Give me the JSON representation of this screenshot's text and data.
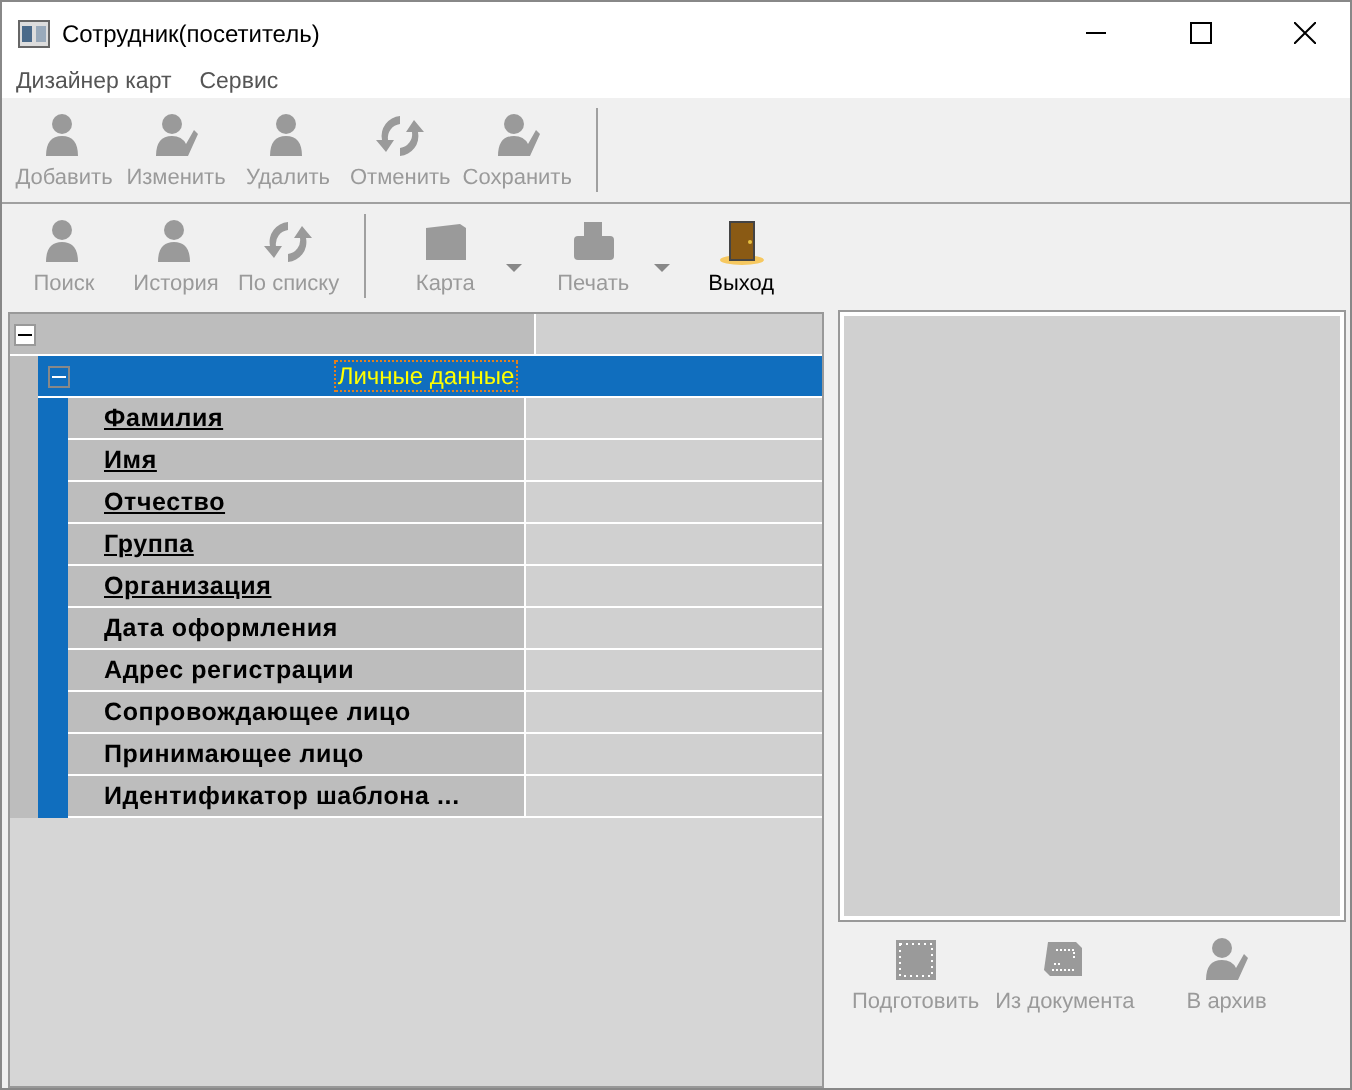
{
  "window": {
    "title": "Сотрудник(посетитель)"
  },
  "menu": [
    "Дизайнер карт",
    "Сервис"
  ],
  "toolbar_1": [
    {
      "label": "Добавить",
      "disabled": true
    },
    {
      "label": "Изменить",
      "disabled": true
    },
    {
      "label": "Удалить",
      "disabled": true
    },
    {
      "label": "Отменить",
      "disabled": true
    },
    {
      "label": "Сохранить",
      "disabled": true
    }
  ],
  "toolbar_2": [
    {
      "label": "Поиск",
      "disabled": true,
      "dropdown": false
    },
    {
      "label": "История",
      "disabled": true,
      "dropdown": false
    },
    {
      "label": "По списку",
      "disabled": true,
      "dropdown": false
    },
    {
      "label": "Карта",
      "disabled": true,
      "dropdown": true
    },
    {
      "label": "Печать",
      "disabled": true,
      "dropdown": true
    },
    {
      "label": "Выход",
      "disabled": false,
      "dropdown": false
    }
  ],
  "tree": {
    "expanded": true,
    "group": {
      "title": "Личные данные",
      "expanded": true,
      "selected": true,
      "fields": [
        {
          "label": "Фамилия",
          "required": true
        },
        {
          "label": "Имя",
          "required": true
        },
        {
          "label": "Отчество",
          "required": true
        },
        {
          "label": "Группа",
          "required": true
        },
        {
          "label": "Организация",
          "required": true
        },
        {
          "label": "Дата оформления",
          "required": false
        },
        {
          "label": "Адрес регистрации",
          "required": false
        },
        {
          "label": "Сопровождающее лицо",
          "required": false
        },
        {
          "label": "Принимающее лицо",
          "required": false
        },
        {
          "label": "Идентификатор шаблона ...",
          "required": false
        }
      ]
    }
  },
  "photo_panel": {
    "buttons": [
      {
        "label": "Подготовить",
        "disabled": true
      },
      {
        "label": "Из документа",
        "disabled": true
      },
      {
        "label": "В архив",
        "disabled": true
      }
    ]
  }
}
